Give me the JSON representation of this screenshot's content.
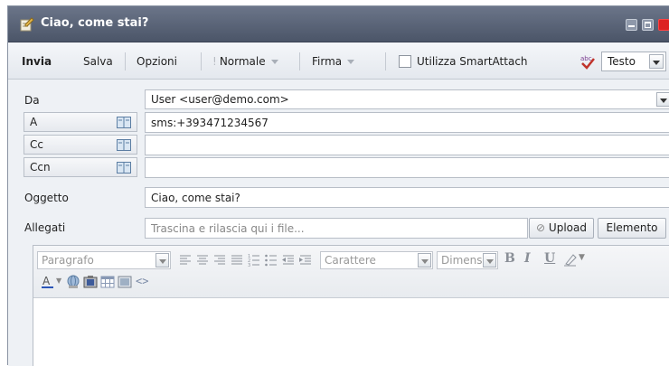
{
  "window": {
    "title": "Ciao, come stai?"
  },
  "toolbar": {
    "send": "Invia",
    "save": "Salva",
    "options": "Opzioni",
    "priority": "Normale",
    "signature": "Firma",
    "smartattach": "Utilizza SmartAttach",
    "format": "Testo"
  },
  "fields": {
    "from_label": "Da",
    "from_value": "User <user@demo.com>",
    "to_label": "A",
    "to_value": "sms:+393471234567",
    "cc_label": "Cc",
    "cc_value": "",
    "bcc_label": "Ccn",
    "bcc_value": "",
    "subject_label": "Oggetto",
    "subject_value": "Ciao, come stai?",
    "attach_label": "Allegati",
    "attach_placeholder": "Trascina e rilascia qui i file...",
    "upload": "Upload",
    "element": "Elemento"
  },
  "editor": {
    "paragraph": "Paragrafo",
    "font": "Carattere",
    "size": "Dimensior",
    "bold": "B",
    "italic": "I",
    "underline": "U",
    "source": "<>"
  },
  "colors": {
    "titlebar": "#5a6478",
    "accent_close": "#dd2222"
  }
}
